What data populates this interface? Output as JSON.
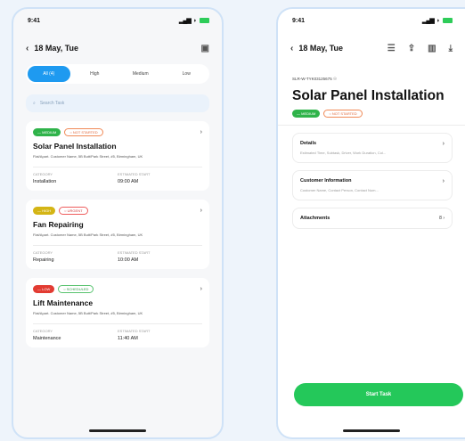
{
  "left": {
    "status": {
      "time": "9:41",
      "signal": "..ll",
      "wifi": "▾"
    },
    "header": {
      "date": "18 May, Tue",
      "back_glyph": "‹",
      "calendar_glyph": "▣"
    },
    "segments": [
      {
        "label": "All (4)",
        "active": true
      },
      {
        "label": "High",
        "active": false
      },
      {
        "label": "Medium",
        "active": false
      },
      {
        "label": "Low",
        "active": false
      }
    ],
    "search": {
      "placeholder": "Search Task",
      "icon": "search-icon"
    },
    "tasks": [
      {
        "priority": "— MEDIUM",
        "state": "○ NOT STARTED",
        "title": "Solar Panel Installation",
        "address": "Flat/Apart. Customer Name, 5B Butt/Park Street, #5, Birmingham, UK",
        "category_label": "CATEGORY",
        "category": "Installation",
        "time_label": "ESTIMATED START",
        "time": "09:00 AM"
      },
      {
        "priority": "— HIGH",
        "state": "○ URGENT",
        "title": "Fan Repairing",
        "address": "Flat/Apart. Customer Name, 5B Butt/Park Street, #5, Birmingham, UK",
        "category_label": "CATEGORY",
        "category": "Repairing",
        "time_label": "ESTIMATED START",
        "time": "10:00 AM"
      },
      {
        "priority": "— LOW",
        "state": "○ SCHEDULED",
        "title": "Lift Maintenance",
        "address": "Flat/Apart. Customer Name, 5B Butt/Park Street, #5, Birmingham, UK",
        "category_label": "CATEGORY",
        "category": "Maintenance",
        "time_label": "ESTIMATED START",
        "time": "11:40 AM"
      }
    ]
  },
  "right": {
    "status": {
      "time": "9:41"
    },
    "header": {
      "date": "18 May, Tue",
      "back_glyph": "‹"
    },
    "ref": "SLR-W-TYK03125675 ☉",
    "title": "Solar Panel Installation",
    "priority": "— MEDIUM",
    "state": "○ NOT STARTED",
    "rows": [
      {
        "label": "Details",
        "sub": "Estimated Time, Subtask, Driver, Work Duration, Col..."
      },
      {
        "label": "Customer Information",
        "sub": "Customer Name, Contact Person, Contact Num..."
      },
      {
        "label": "Attachments",
        "count": "8 ›"
      }
    ],
    "start_button": "Start Task",
    "colors": {
      "accent": "#1e9af0",
      "start": "#24c85a"
    }
  }
}
